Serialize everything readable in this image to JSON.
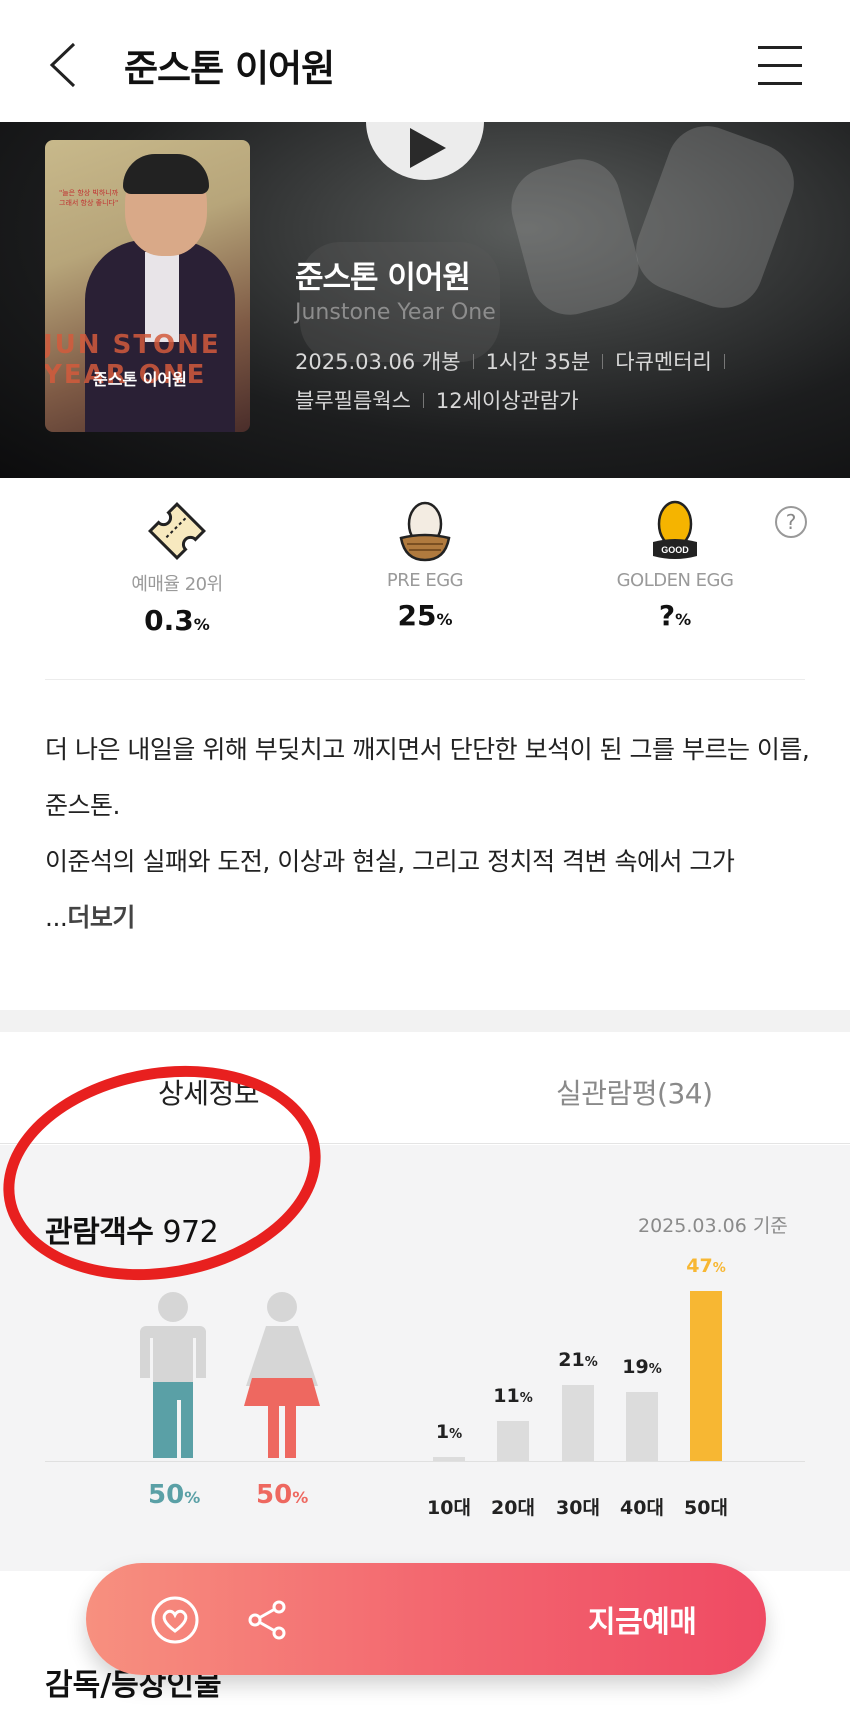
{
  "header": {
    "title": "준스톤 이어원"
  },
  "movie": {
    "title": "준스톤 이어원",
    "title_en": "Junstone Year One",
    "release": "2025.03.06 개봉",
    "runtime": "1시간 35분",
    "genre": "다큐멘터리",
    "distributor": "블루필름웍스",
    "rating": "12세이상관람가",
    "poster_title": "준스톤 이어원",
    "poster_big": "JUN STONE YEAR ONE"
  },
  "stats": [
    {
      "icon": "ticket-icon",
      "label": "예매율 20위",
      "value": "0.3",
      "unit": "%"
    },
    {
      "icon": "egg-icon",
      "label": "PRE EGG",
      "value": "25",
      "unit": "%"
    },
    {
      "icon": "golden-egg-icon",
      "label": "GOLDEN EGG",
      "value": "?",
      "unit": "%"
    }
  ],
  "description": {
    "text": "더 나은 내일을 위해 부딪치고 깨지면서 단단한 보석이 된 그를 부르는 이름, 준스톤.",
    "text2": "이준석의 실패와 도전, 이상과 현실, 그리고 정치적 격변 속에서 그가",
    "ellipsis": "...",
    "more": "더보기"
  },
  "tabs": [
    {
      "label": "상세정보",
      "active": true
    },
    {
      "label": "실관람평(34)",
      "active": false
    }
  ],
  "audience": {
    "title": "관람객수",
    "count": "972",
    "date": "2025.03.06 기준",
    "gender": {
      "male": "50",
      "female": "50",
      "unit": "%"
    },
    "age_labels": [
      "10대",
      "20대",
      "30대",
      "40대",
      "50대"
    ],
    "age_values": [
      1,
      11,
      21,
      19,
      47
    ],
    "age_texts": [
      "1",
      "11",
      "21",
      "19",
      "47"
    ],
    "highlight_color": "#f7b733",
    "bar_color": "#dcdcdc"
  },
  "cta": {
    "label": "지금예매"
  },
  "section": {
    "title": "감독/등장인물"
  }
}
